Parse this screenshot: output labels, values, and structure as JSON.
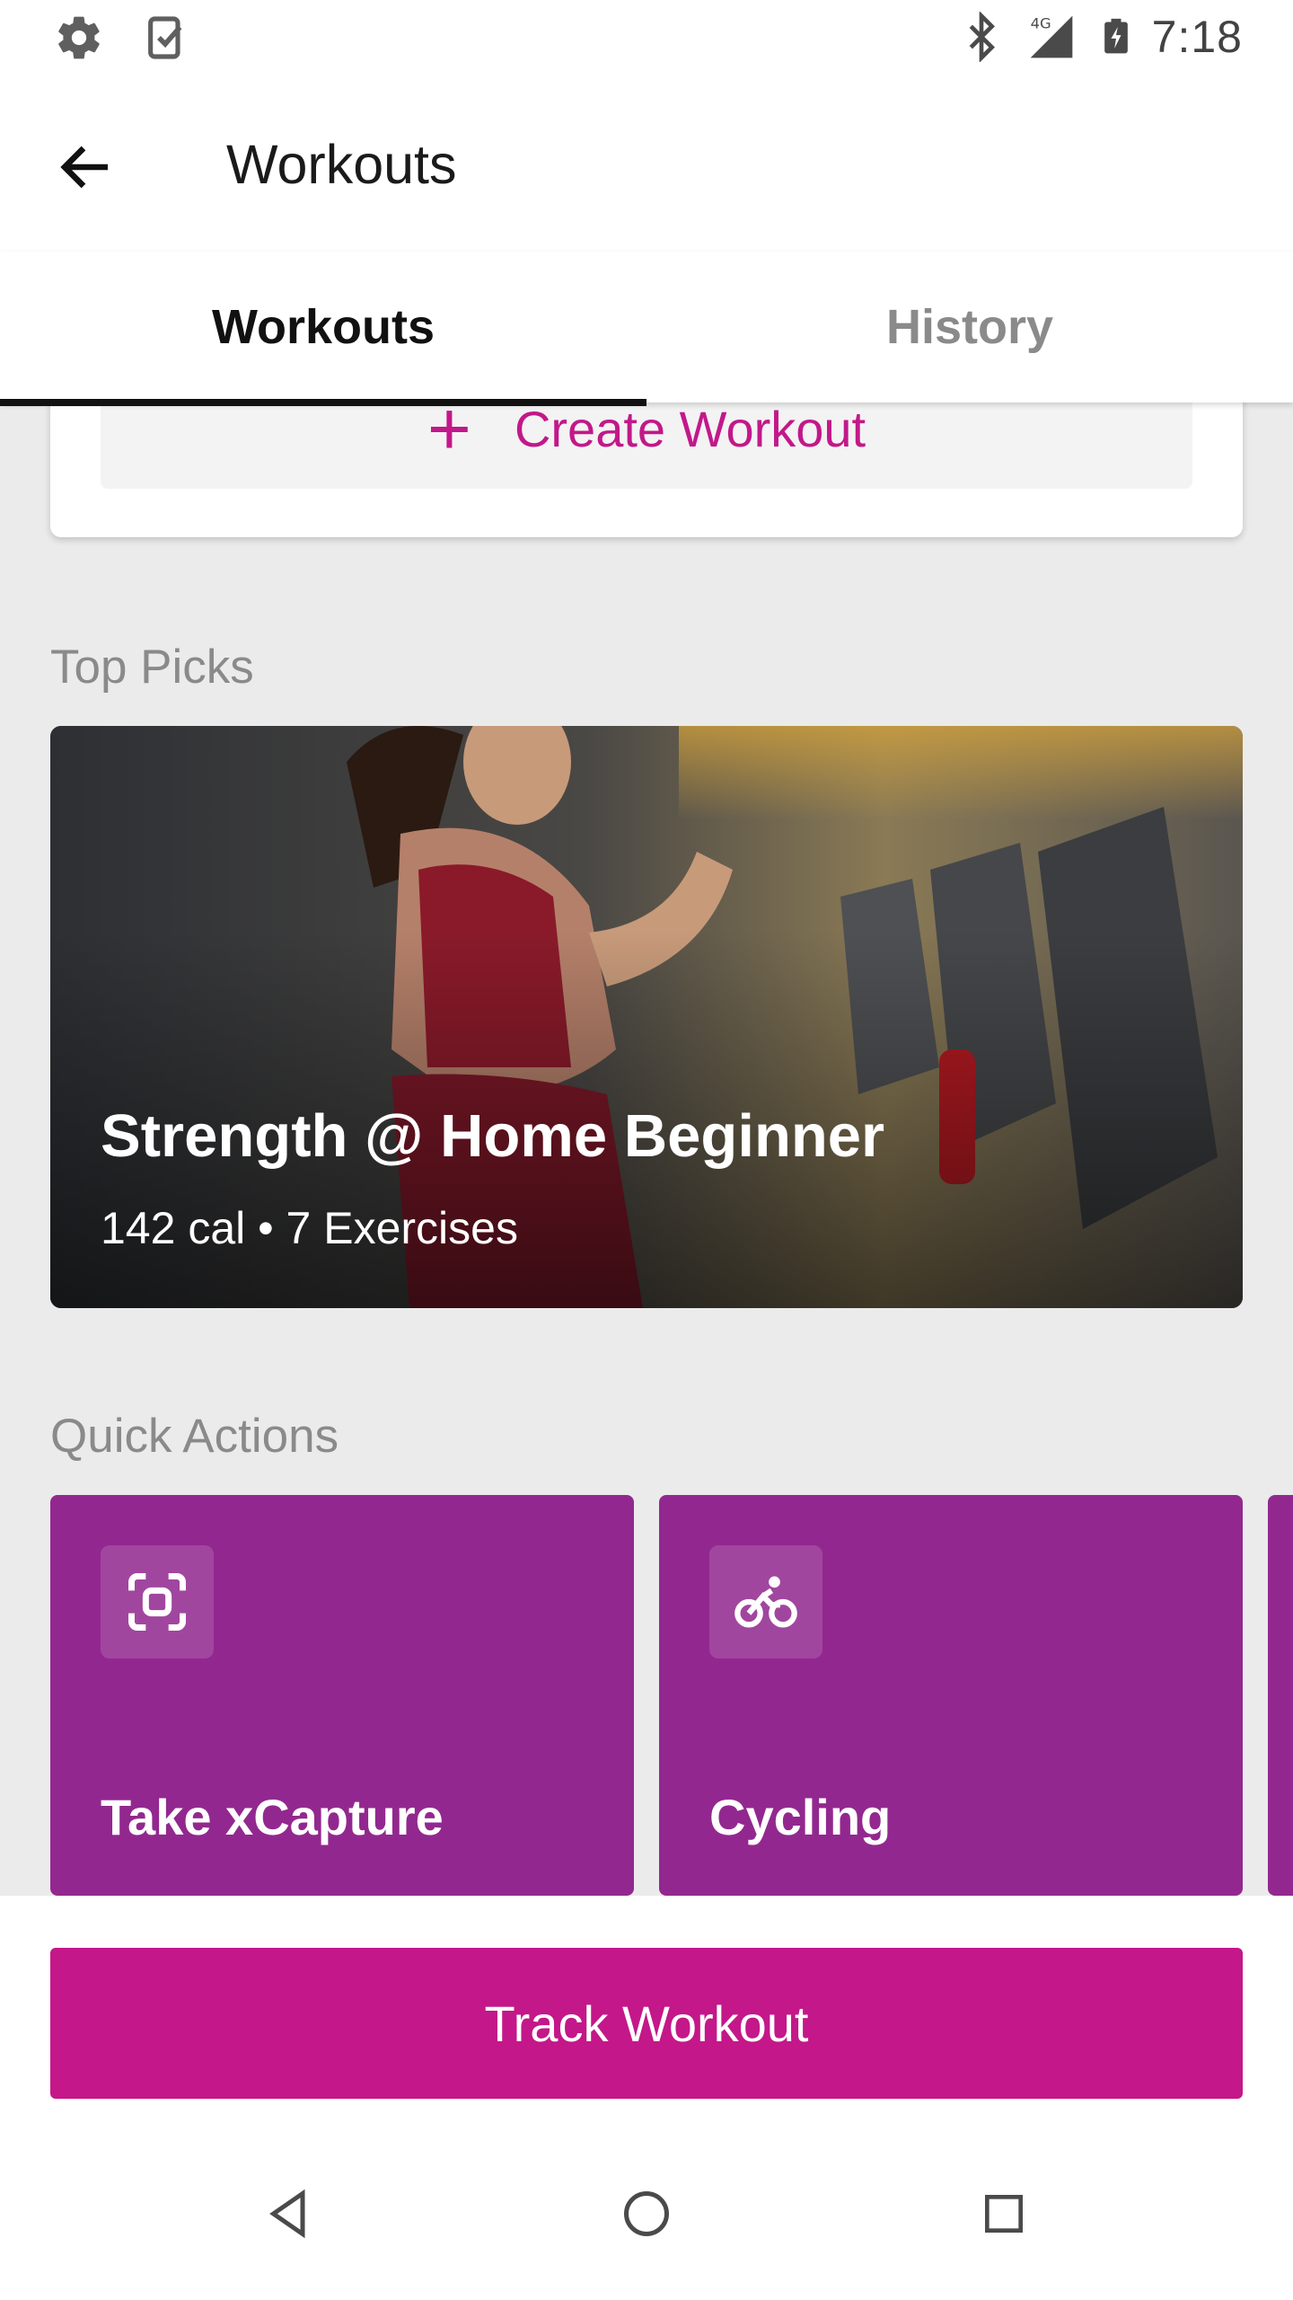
{
  "status_bar": {
    "time": "7:18",
    "network": "4G",
    "icons": [
      "settings-icon",
      "task-check-icon",
      "bluetooth-icon",
      "signal-icon",
      "battery-charging-icon"
    ]
  },
  "app_bar": {
    "title": "Workouts",
    "back_icon": "arrow-back-icon"
  },
  "tabs": [
    {
      "label": "Workouts",
      "active": true
    },
    {
      "label": "History",
      "active": false
    }
  ],
  "create_workout": {
    "label": "Create Workout",
    "icon": "plus-icon"
  },
  "top_picks": {
    "heading": "Top Picks",
    "items": [
      {
        "title": "Strength @ Home Beginner",
        "subtitle": "142 cal • 7 Exercises"
      }
    ]
  },
  "quick_actions": {
    "heading": "Quick Actions",
    "items": [
      {
        "label": "Take xCapture",
        "icon": "capture-frame-icon"
      },
      {
        "label": "Cycling",
        "icon": "cycling-icon"
      }
    ]
  },
  "track_button": {
    "label": "Track Workout"
  },
  "nav_bar": {
    "icons": [
      "nav-back-icon",
      "nav-home-icon",
      "nav-recents-icon"
    ]
  },
  "colors": {
    "accent": "#c41789",
    "quick_action_bg": "#92288f",
    "background": "#ebebeb"
  }
}
